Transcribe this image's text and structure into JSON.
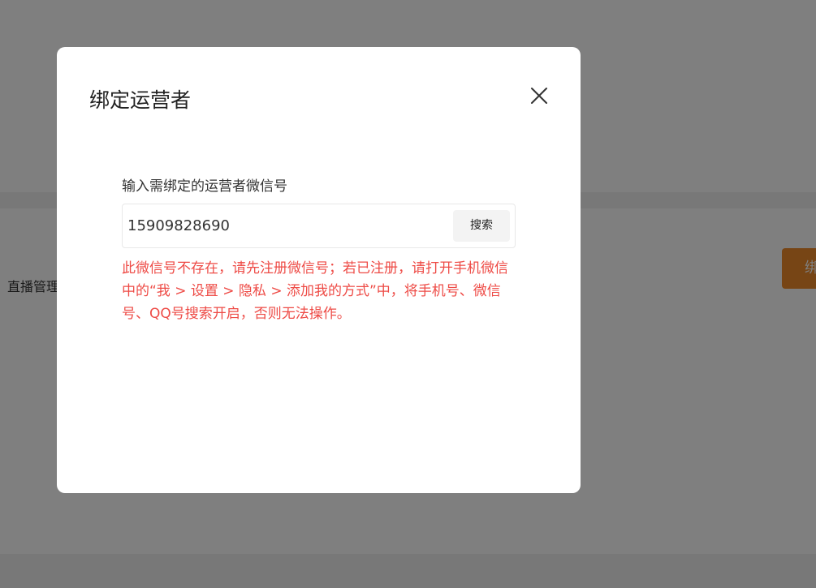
{
  "background": {
    "label": "直播管理",
    "button_label": "绑定"
  },
  "modal": {
    "title": "绑定运营者",
    "close_icon": "close-icon",
    "field_label": "输入需绑定的运营者微信号",
    "input_value": "15909828690",
    "search_button_label": "搜索",
    "error_message": "此微信号不存在，请先注册微信号；若已注册，请打开手机微信中的“我 > 设置 > 隐私 > 添加我的方式”中，将手机号、微信号、QQ号搜索开启，否则无法操作。"
  },
  "colors": {
    "error": "#ee4b46",
    "accent": "#ee8a2a",
    "overlay": "rgba(0,0,0,0.5)"
  }
}
